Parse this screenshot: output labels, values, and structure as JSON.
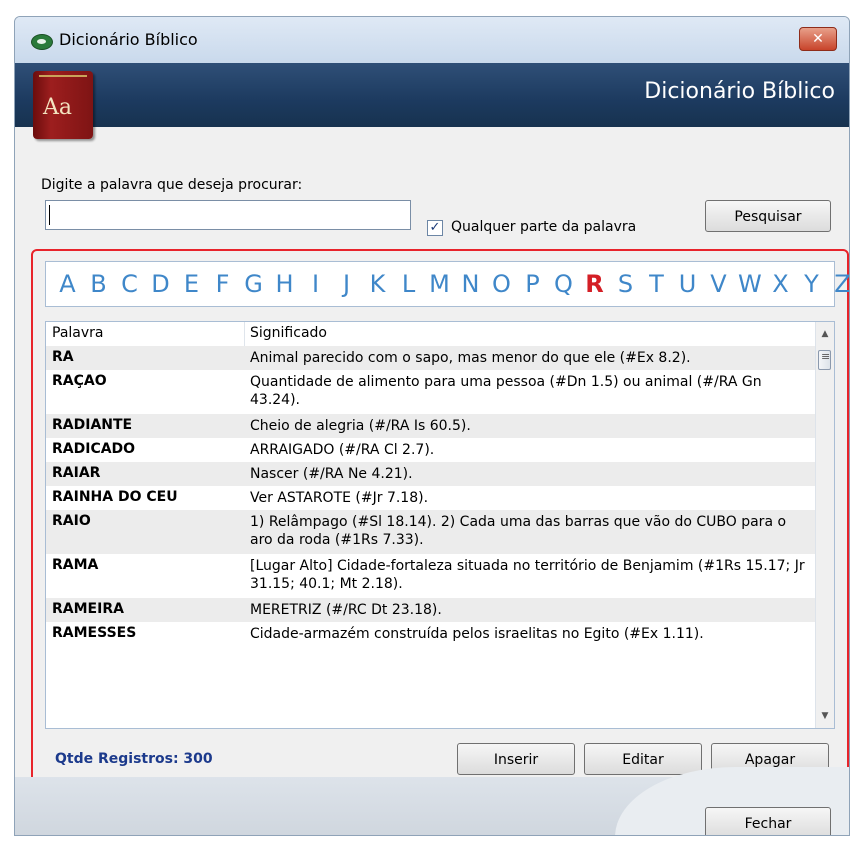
{
  "window": {
    "title": "Dicionário Bíblico",
    "close_glyph": "✕"
  },
  "banner": {
    "book_text": "Aa",
    "title": "Dicionário Bíblico"
  },
  "search": {
    "label": "Digite a palavra que deseja procurar:",
    "value": "",
    "checkbox_checked": true,
    "checkbox_glyph": "✓",
    "checkbox_label": "Qualquer parte da palavra",
    "button": "Pesquisar"
  },
  "alphabet": {
    "letters": [
      "A",
      "B",
      "C",
      "D",
      "E",
      "F",
      "G",
      "H",
      "I",
      "J",
      "K",
      "L",
      "M",
      "N",
      "O",
      "P",
      "Q",
      "R",
      "S",
      "T",
      "U",
      "V",
      "W",
      "X",
      "Y",
      "Z"
    ],
    "active": "R"
  },
  "table": {
    "columns": [
      "Palavra",
      "Significado"
    ],
    "rows": [
      {
        "word": "RA",
        "meaning": "Animal parecido com o sapo, mas menor do que ele (#Ex 8.2)."
      },
      {
        "word": "RAÇAO",
        "meaning": "Quantidade de alimento para uma pessoa (#Dn 1.5) ou animal (#/RA Gn 43.24)."
      },
      {
        "word": "RADIANTE",
        "meaning": "Cheio de alegria (#/RA Is 60.5)."
      },
      {
        "word": "RADICADO",
        "meaning": "ARRAIGADO (#/RA Cl 2.7)."
      },
      {
        "word": "RAIAR",
        "meaning": "Nascer (#/RA Ne 4.21)."
      },
      {
        "word": "RAINHA DO CEU",
        "meaning": "Ver ASTAROTE (#Jr 7.18)."
      },
      {
        "word": "RAIO",
        "meaning": "1) Relâmpago (#Sl 18.14). 2) Cada uma das barras que vão do CUBO para o aro da roda (#1Rs 7.33)."
      },
      {
        "word": "RAMA",
        "meaning": "[Lugar Alto] Cidade-fortaleza situada no território de Benjamim (#1Rs 15.17; Jr 31.15; 40.1; Mt 2.18)."
      },
      {
        "word": "RAMEIRA",
        "meaning": "MERETRIZ (#/RC Dt 23.18)."
      },
      {
        "word": "RAMESSES",
        "meaning": "Cidade-armazém construída pelos israelitas no Egito (#Ex 1.11)."
      }
    ],
    "scroll_up_glyph": "▲",
    "scroll_down_glyph": "▼"
  },
  "footer": {
    "count_label": "Qtde Registros: 300",
    "insert": "Inserir",
    "edit": "Editar",
    "delete": "Apagar",
    "close": "Fechar"
  },
  "colors": {
    "accent_red": "#e8242b",
    "letter_blue": "#3f87c9",
    "banner_navy": "#1c3a5f",
    "count_blue": "#1c3a8c"
  }
}
